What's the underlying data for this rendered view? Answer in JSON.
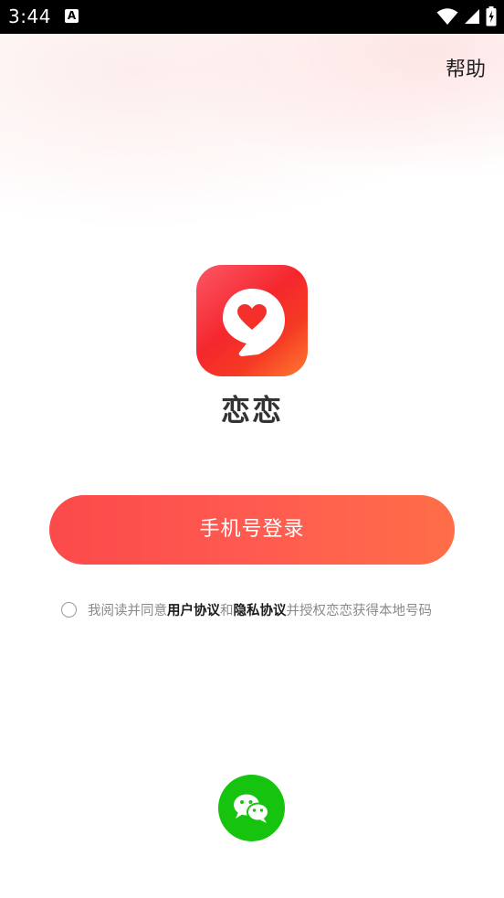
{
  "status_bar": {
    "time": "3:44",
    "notification_badge": "A",
    "icons": [
      "wifi-icon",
      "cell-signal-icon",
      "battery-charging-icon"
    ]
  },
  "header": {
    "help_label": "帮助"
  },
  "app": {
    "name": "恋恋",
    "logo_icon": "heart-location-pin-icon",
    "brand_color": "#f5302a"
  },
  "login": {
    "phone_login_label": "手机号登录"
  },
  "agreement": {
    "prefix": "我阅读并同意",
    "user_agreement": "用户协议",
    "conjunction": "和",
    "privacy_agreement": "隐私协议",
    "suffix": "并授权恋恋获得本地号码",
    "checked": false
  },
  "social_login": {
    "wechat_icon": "wechat-icon",
    "wechat_color": "#16c40f"
  }
}
